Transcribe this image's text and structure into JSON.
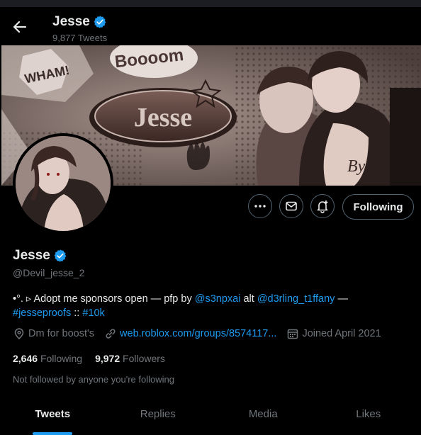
{
  "header": {
    "title": "Jesse",
    "tweet_count": "9,877 Tweets"
  },
  "banner": {
    "logo_text": "Jesse",
    "bubble_boom": "Boooom",
    "bubble_whaam": "WHAM!",
    "signature": "By"
  },
  "actions": {
    "following_label": "Following"
  },
  "profile": {
    "name": "Jesse",
    "handle": "@Devil_jesse_2",
    "bio": {
      "part1": "•°. ▹ Adopt me sponsors open — pfp by ",
      "mention1": "@s3npxai",
      "part2": " alt ",
      "mention2": "@d3rling_t1ffany",
      "part3": " —",
      "hashtag1": "#jesseproofs",
      "sep": " :: ",
      "hashtag2": "#10k"
    },
    "location": "Dm for boost's",
    "website": "web.roblox.com/groups/8574117...",
    "joined": "Joined April 2021",
    "following_count": "2,646",
    "following_label": "Following",
    "followers_count": "9,972",
    "followers_label": "Followers",
    "not_followed": "Not followed by anyone you're following"
  },
  "tabs": [
    "Tweets",
    "Replies",
    "Media",
    "Likes"
  ],
  "colors": {
    "accent": "#1d9bf0",
    "muted": "#71767b",
    "text": "#e7e9ea",
    "background": "#000000"
  }
}
